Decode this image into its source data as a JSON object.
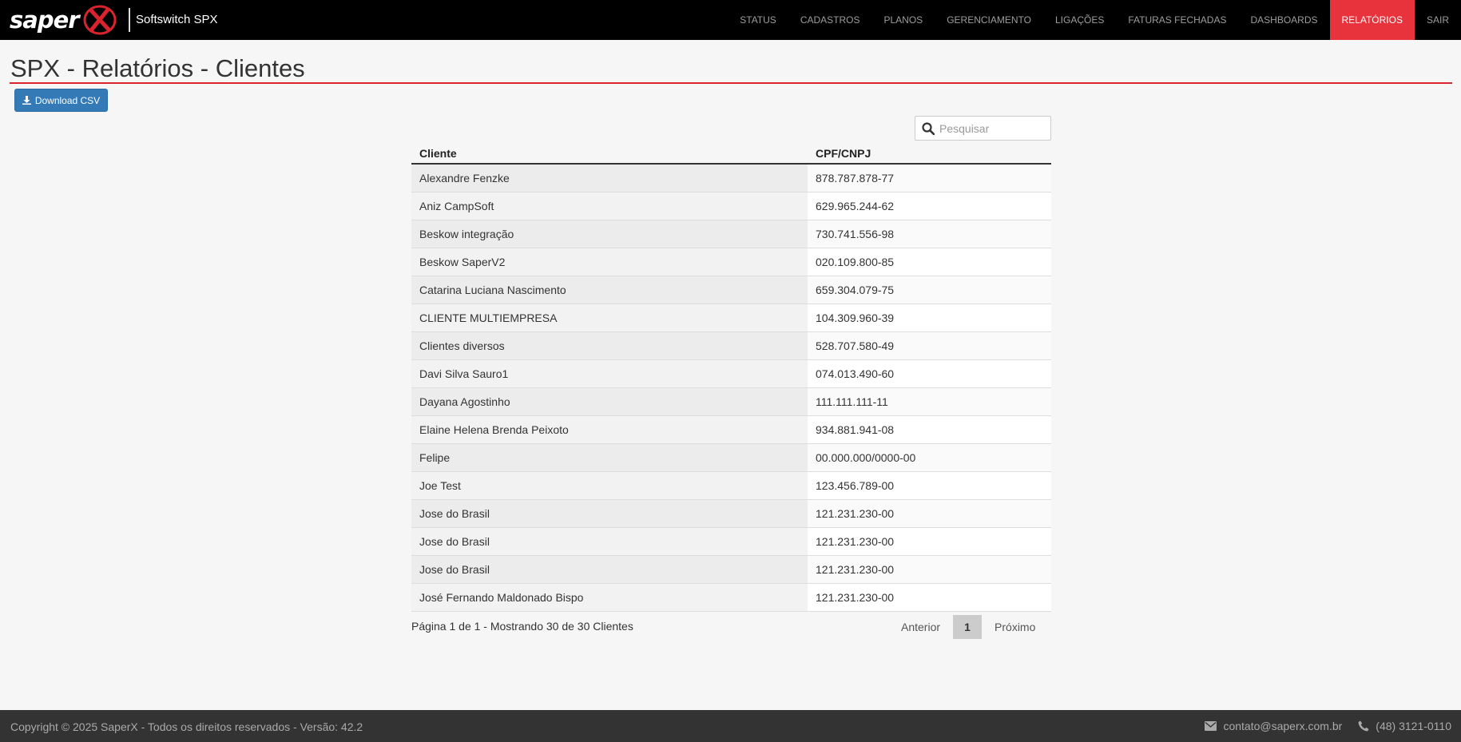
{
  "header": {
    "brand_name": "Softswitch SPX",
    "nav": [
      {
        "label": "STATUS"
      },
      {
        "label": "CADASTROS"
      },
      {
        "label": "PLANOS"
      },
      {
        "label": "GERENCIAMENTO"
      },
      {
        "label": "LIGAÇÕES"
      },
      {
        "label": "FATURAS FECHADAS"
      },
      {
        "label": "DASHBOARDS"
      },
      {
        "label": "RELATÓRIOS",
        "active": true
      },
      {
        "label": "SAIR"
      }
    ]
  },
  "page": {
    "title": "SPX - Relatórios - Clientes",
    "download_label": "Download CSV"
  },
  "search": {
    "placeholder": "Pesquisar"
  },
  "table": {
    "columns": [
      "Cliente",
      "CPF/CNPJ"
    ],
    "rows": [
      [
        "Alexandre Fenzke",
        "878.787.878-77"
      ],
      [
        "Aniz CampSoft",
        "629.965.244-62"
      ],
      [
        "Beskow integração",
        "730.741.556-98"
      ],
      [
        "Beskow SaperV2",
        "020.109.800-85"
      ],
      [
        "Catarina Luciana Nascimento",
        "659.304.079-75"
      ],
      [
        "CLIENTE MULTIEMPRESA",
        "104.309.960-39"
      ],
      [
        "Clientes diversos",
        "528.707.580-49"
      ],
      [
        "Davi Silva Sauro1",
        "074.013.490-60"
      ],
      [
        "Dayana Agostinho",
        "111.111.111-11"
      ],
      [
        "Elaine Helena Brenda Peixoto",
        "934.881.941-08"
      ],
      [
        "Felipe",
        "00.000.000/0000-00"
      ],
      [
        "Joe Test",
        "123.456.789-00"
      ],
      [
        "Jose do Brasil",
        "121.231.230-00"
      ],
      [
        "Jose do Brasil",
        "121.231.230-00"
      ],
      [
        "Jose do Brasil",
        "121.231.230-00"
      ],
      [
        "José Fernando Maldonado Bispo",
        "121.231.230-00"
      ]
    ]
  },
  "pagination": {
    "info": "Página 1 de 1 - Mostrando 30 de 30 Clientes",
    "prev_label": "Anterior",
    "current": "1",
    "next_label": "Próximo"
  },
  "footer": {
    "copyright": "Copyright © 2025 SaperX - Todos os direitos reservados - Versão: 42.2",
    "email": "contato@saperx.com.br",
    "phone": "(48) 3121-0110"
  },
  "colors": {
    "brand_red": "#e8333c",
    "primary_blue": "#337ab7",
    "header_bg": "#000000",
    "footer_bg": "#333333"
  }
}
